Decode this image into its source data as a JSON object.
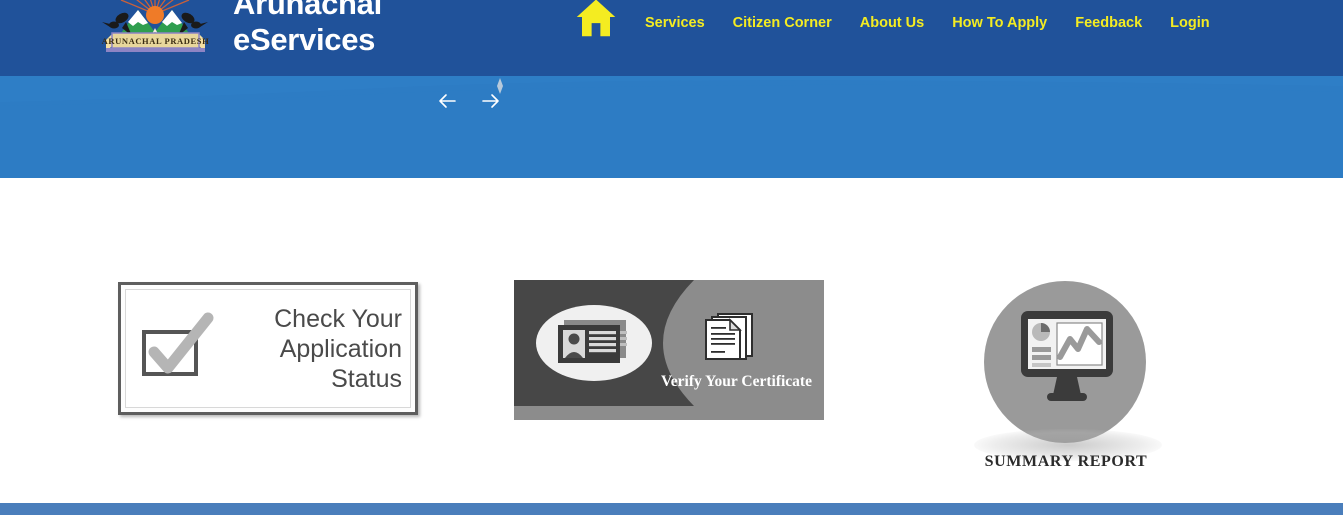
{
  "site": {
    "title": "Arunachal\neServices",
    "emblem_caption": "ARUNACHAL PRADESH",
    "header_bg": "#20529a",
    "banner_bg": "#2d7cc4",
    "nav_color": "#f4ec21",
    "footer_bg": "#4a7ebb"
  },
  "nav": {
    "home_icon": "home-icon",
    "items": [
      {
        "label": "Services"
      },
      {
        "label": "Citizen Corner"
      },
      {
        "label": "About Us"
      },
      {
        "label": "How To Apply"
      },
      {
        "label": "Feedback"
      },
      {
        "label": "Login"
      }
    ]
  },
  "carousel": {
    "prev_icon": "arrow-left-icon",
    "next_icon": "arrow-right-icon"
  },
  "cards": {
    "status": {
      "label": "Check Your\nApplication\nStatus",
      "icon": "checkbox-check-icon"
    },
    "verify": {
      "label": "Verify Your Certificate",
      "icon_left": "id-card-icon",
      "icon_right": "document-stack-icon"
    },
    "summary": {
      "label": "SUMMARY REPORT",
      "icon": "monitor-chart-icon"
    }
  }
}
